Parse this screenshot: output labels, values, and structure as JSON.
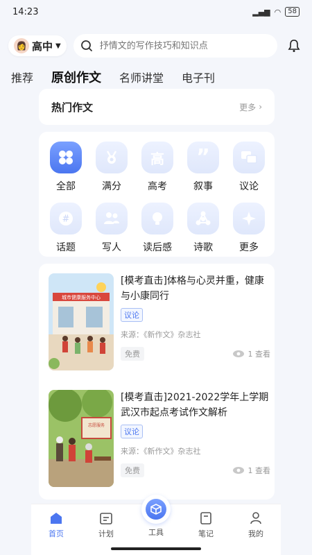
{
  "status": {
    "time": "14:23",
    "battery": "58"
  },
  "header": {
    "grade": "高中",
    "search_placeholder": "抒情文的写作技巧和知识点"
  },
  "tabs": [
    {
      "label": "推荐",
      "active": false
    },
    {
      "label": "原创作文",
      "active": true
    },
    {
      "label": "名师讲堂",
      "active": false
    },
    {
      "label": "电子刊",
      "active": false
    }
  ],
  "hot": {
    "title": "热门作文",
    "more": "更多"
  },
  "categories": [
    {
      "label": "全部",
      "icon": "grid-icon"
    },
    {
      "label": "满分",
      "icon": "medal-icon"
    },
    {
      "label": "高考",
      "icon": "gaokao-icon"
    },
    {
      "label": "叙事",
      "icon": "quote-icon"
    },
    {
      "label": "议论",
      "icon": "chat-icon"
    },
    {
      "label": "话题",
      "icon": "hashtag-icon"
    },
    {
      "label": "写人",
      "icon": "people-icon"
    },
    {
      "label": "读后感",
      "icon": "bulb-icon"
    },
    {
      "label": "诗歌",
      "icon": "network-icon"
    },
    {
      "label": "更多",
      "icon": "sparkle-icon"
    }
  ],
  "articles": [
    {
      "title": "[模考直击]体格与心灵并重，健康与小康同行",
      "tag": "议论",
      "source": "来源：《新作文》杂志社",
      "price": "免费",
      "views": "1 查看",
      "image_text": "城市健康服务中心"
    },
    {
      "title": "[模考直击]2021-2022学年上学期 武汉市起点考试作文解析",
      "tag": "议论",
      "source": "来源：《新作文》杂志社",
      "price": "免费",
      "views": "1 查看",
      "image_text": "志愿服务"
    }
  ],
  "nav": [
    {
      "label": "首页"
    },
    {
      "label": "计划"
    },
    {
      "label": "工具"
    },
    {
      "label": "笔记"
    },
    {
      "label": "我的"
    }
  ],
  "colors": {
    "accent": "#4b76f0",
    "page_bg": "#f4f6fb"
  }
}
